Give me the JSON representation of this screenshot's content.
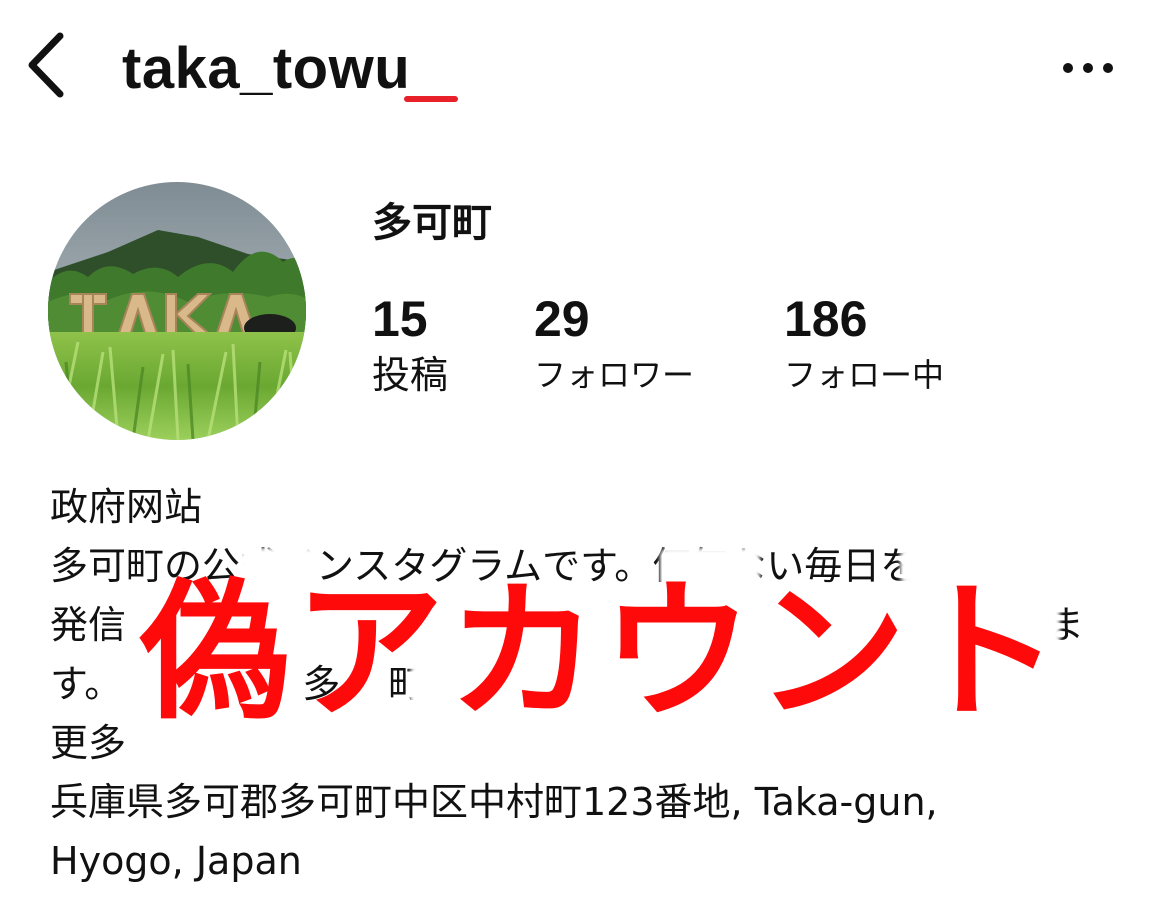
{
  "header": {
    "username": "taka_towu",
    "back_icon": "chevron-left-icon",
    "more_icon": "more-horizontal-icon",
    "underline_color": "#e8202a"
  },
  "profile": {
    "display_name": "多可町",
    "avatar_icon": "profile-avatar",
    "stats": {
      "posts": {
        "count": "15",
        "label": "投稿"
      },
      "followers": {
        "count": "29",
        "label": "フォロワー"
      },
      "following": {
        "count": "186",
        "label": "フォロー中"
      }
    }
  },
  "bio": {
    "category": "政府网站",
    "line1": "多可町の公式インスタグラムです。何気ない毎日を",
    "line2": "発信",
    "line2_tail": "ま",
    "line3": "す。",
    "line3_mid": "多",
    "line3_mid2": "町",
    "more": "更多",
    "address": "兵庫県多可郡多可町中区中村町123番地, Taka-gun,",
    "address2": "Hyogo, Japan"
  },
  "overlay": {
    "text": "偽アカウント",
    "color": "#ff0a0a"
  }
}
